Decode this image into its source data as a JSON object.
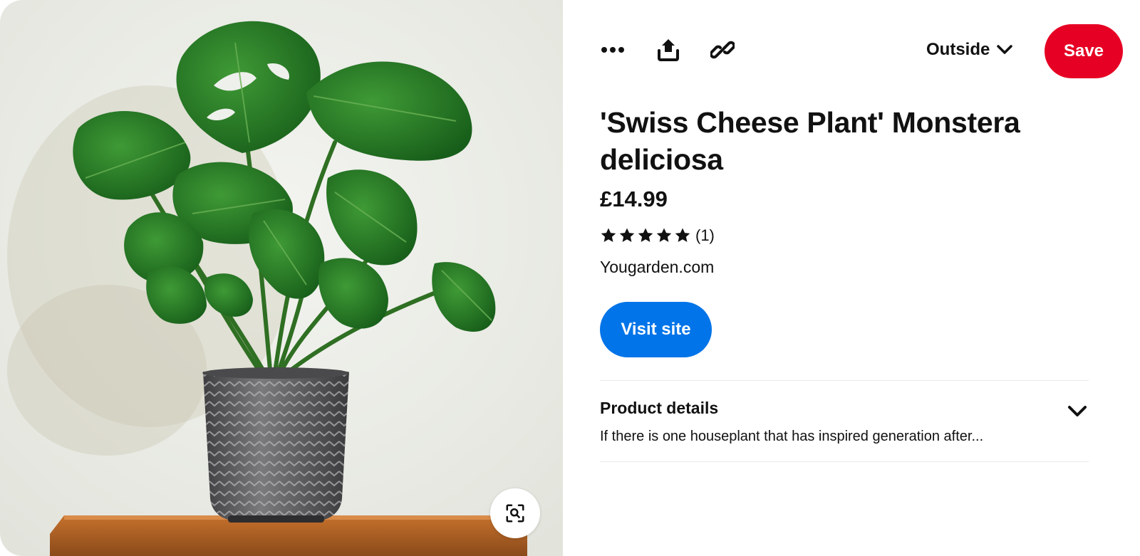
{
  "toolbar": {
    "more_icon": "more-dots-icon",
    "share_icon": "share-upload-icon",
    "link_icon": "link-chain-icon",
    "board_name": "Outside",
    "board_chevron_icon": "chevron-down-icon",
    "save_label": "Save",
    "save_color": "#e60023"
  },
  "image": {
    "alt_subject": "Monstera plant in grey knit-pattern pot",
    "lens_icon": "visual-search-icon"
  },
  "product": {
    "title": "'Swiss Cheese Plant' Monstera deliciosa",
    "price": "£14.99",
    "rating_stars": 5,
    "rating_count": "(1)",
    "source": "Yougarden.com",
    "visit_label": "Visit site",
    "visit_color": "#0074e8"
  },
  "details_section": {
    "title": "Product details",
    "description": "If there is one houseplant that has inspired generation after...",
    "chevron_icon": "chevron-down-icon"
  }
}
